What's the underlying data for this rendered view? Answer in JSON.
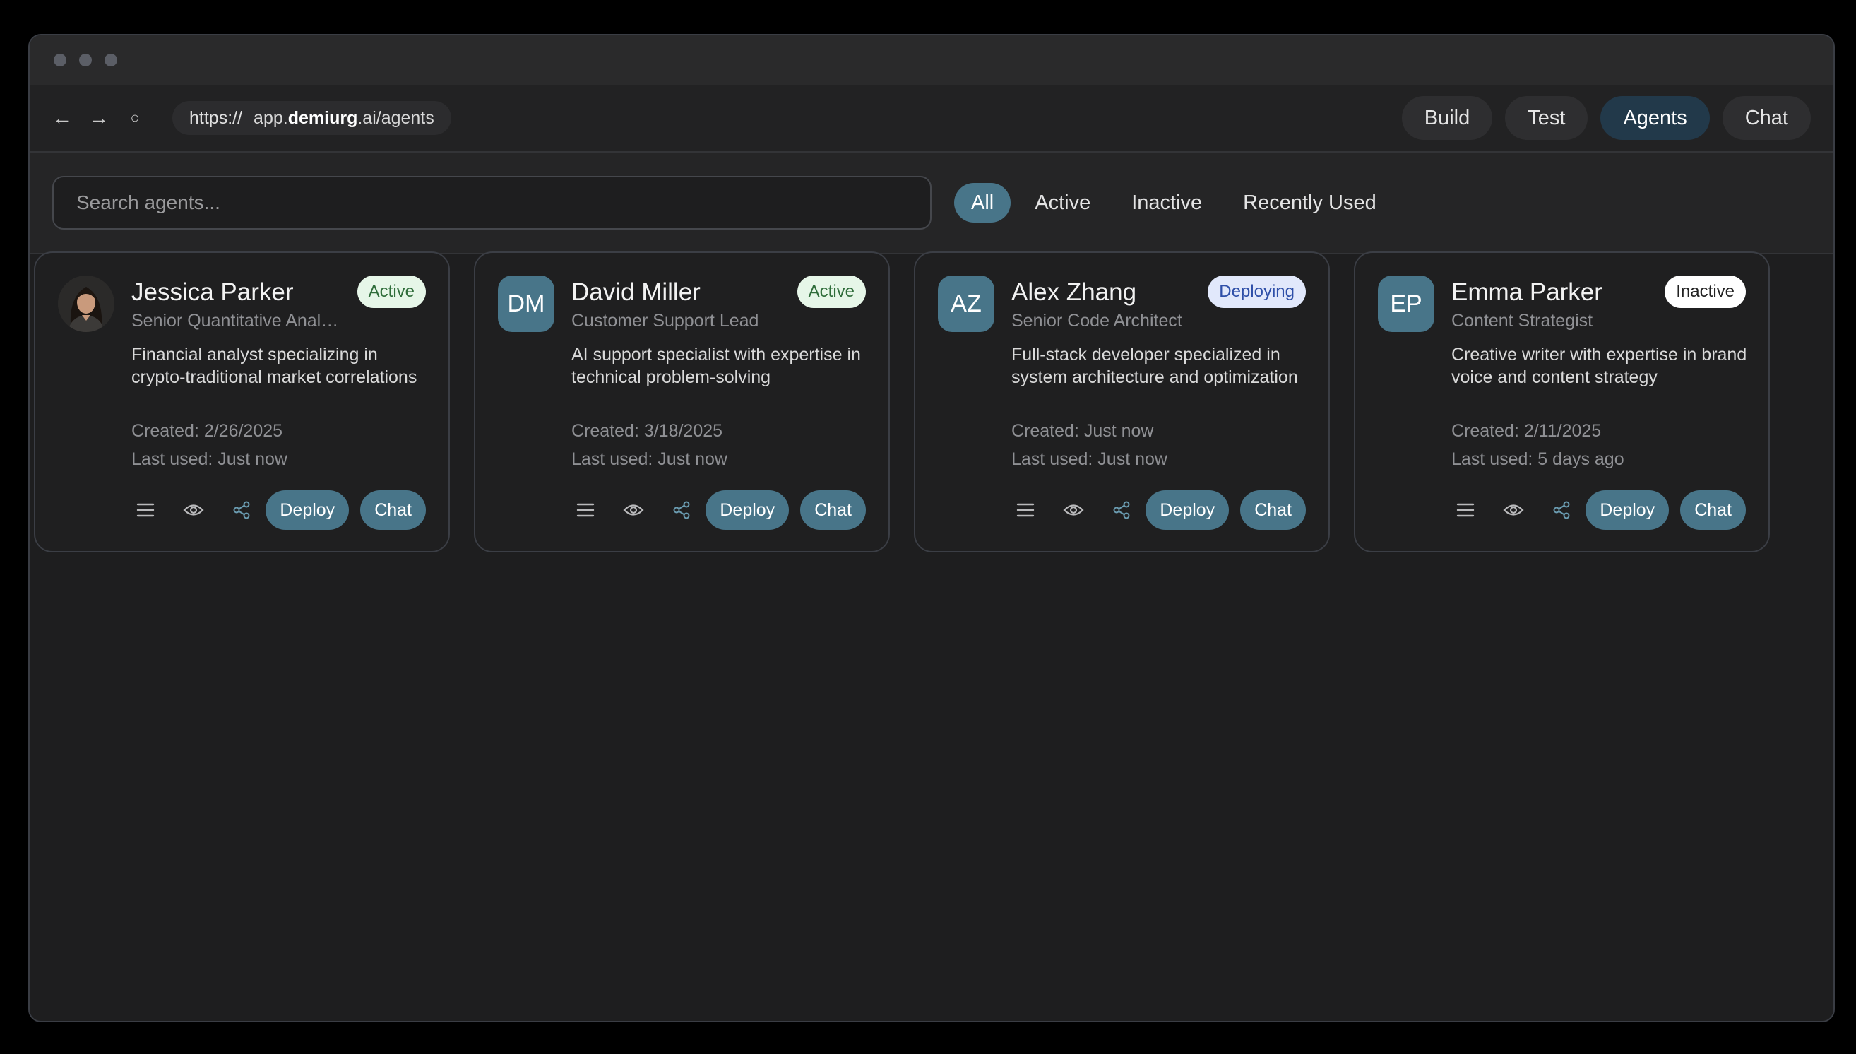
{
  "browser": {
    "url_protocol": "https://",
    "url_prefix": "app.",
    "url_domain": "demiurg",
    "url_suffix": ".ai/agents"
  },
  "top_tabs": [
    {
      "label": "Build",
      "active": false
    },
    {
      "label": "Test",
      "active": false
    },
    {
      "label": "Agents",
      "active": true
    },
    {
      "label": "Chat",
      "active": false
    }
  ],
  "search": {
    "placeholder": "Search agents..."
  },
  "filters": [
    {
      "label": "All",
      "active": true
    },
    {
      "label": "Active",
      "active": false
    },
    {
      "label": "Inactive",
      "active": false
    },
    {
      "label": "Recently Used",
      "active": false
    }
  ],
  "agents": [
    {
      "name": "Jessica Parker",
      "role": "Senior Quantitative Analyst",
      "initials": "",
      "avatar_type": "photo",
      "status": "Active",
      "status_color": "#e6f6e8",
      "description": "Financial analyst specializing in crypto-traditional market correlations",
      "created": "Created: 2/26/2025",
      "last_used": "Last used: Just now",
      "deploy_label": "Deploy",
      "chat_label": "Chat"
    },
    {
      "name": "David Miller",
      "role": "Customer Support Lead",
      "initials": "DM",
      "avatar_type": "initials",
      "status": "Active",
      "status_color": "#e6f6e8",
      "description": "AI support specialist with expertise in technical problem-solving",
      "created": "Created: 3/18/2025",
      "last_used": "Last used: Just now",
      "deploy_label": "Deploy",
      "chat_label": "Chat"
    },
    {
      "name": "Alex Zhang",
      "role": "Senior Code Architect",
      "initials": "AZ",
      "avatar_type": "initials",
      "status": "Deploying",
      "status_color": "#e1e8fb",
      "description": "Full-stack developer specialized in system architecture and optimization",
      "created": "Created: Just now",
      "last_used": "Last used: Just now",
      "deploy_label": "Deploy",
      "chat_label": "Chat"
    },
    {
      "name": "Emma Parker",
      "role": "Content Strategist",
      "initials": "EP",
      "avatar_type": "initials",
      "status": "Inactive",
      "status_color": "#ffffff",
      "description": "Creative writer with expertise in brand voice and content strategy",
      "created": "Created: 2/11/2025",
      "last_used": "Last used: 5 days ago",
      "deploy_label": "Deploy",
      "chat_label": "Chat"
    }
  ],
  "icons": [
    "back-arrow-icon",
    "forward-arrow-icon",
    "reload-icon",
    "menu-icon",
    "eye-icon",
    "share-icon"
  ],
  "colors": {
    "accent": "#487589",
    "active_tab": "#22394a",
    "background": "#1e1e1f"
  }
}
